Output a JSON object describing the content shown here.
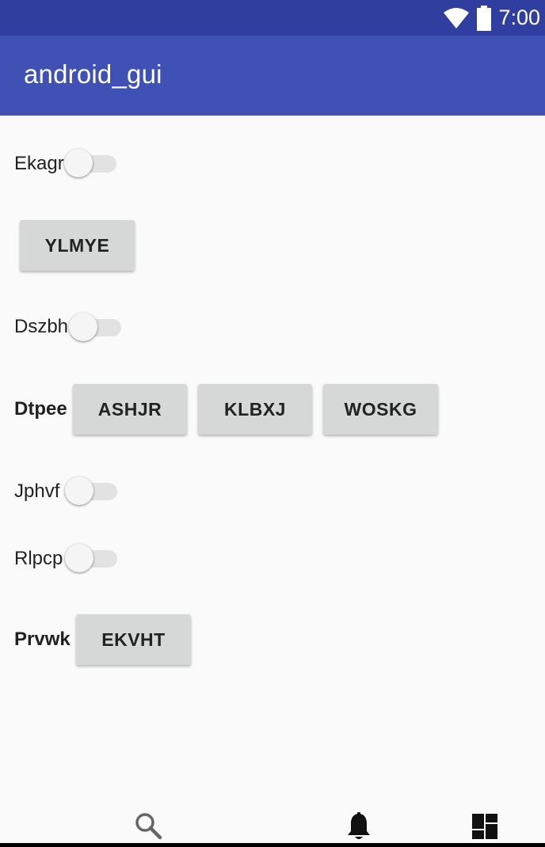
{
  "status_bar": {
    "time": "7:00",
    "icons": [
      "wifi-icon",
      "battery-icon"
    ]
  },
  "app_bar": {
    "title": "android_gui"
  },
  "rows": {
    "ekagr": {
      "label": "Ekagr",
      "switch_on": false
    },
    "ylmye": {
      "button_label": "YLMYE"
    },
    "dszbh": {
      "label": "Dszbh",
      "switch_on": false
    },
    "dtpee": {
      "label": "Dtpee",
      "buttons": [
        "ASHJR",
        "KLBXJ",
        "WOSKG"
      ]
    },
    "jphvf": {
      "label": "Jphvf",
      "switch_on": false
    },
    "rlpcp": {
      "label": "Rlpcp",
      "switch_on": false
    },
    "prvwk": {
      "label": "Prvwk",
      "button_label": "EKVHT"
    }
  },
  "bottom_nav": {
    "items": [
      "search-icon",
      "notification-bell-icon",
      "dashboard-icon"
    ]
  },
  "colors": {
    "status_bar": "#303f9f",
    "app_bar": "#3f51b5",
    "background": "#fafafa",
    "button": "#d6d7d7"
  }
}
